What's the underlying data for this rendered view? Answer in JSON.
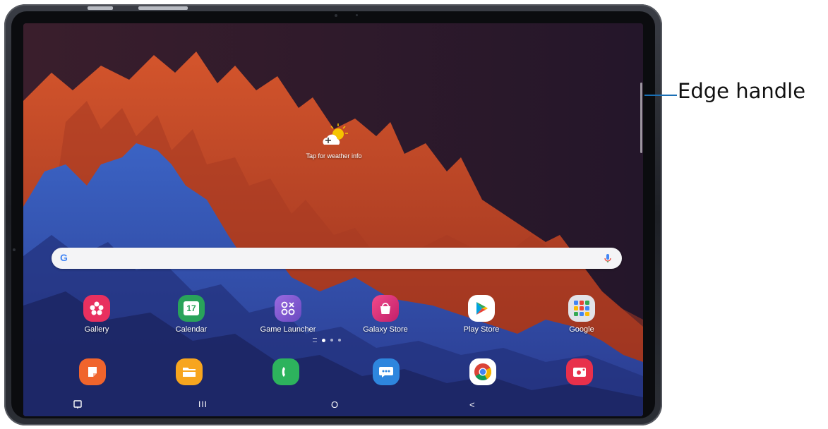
{
  "weather": {
    "label": "Tap for weather info"
  },
  "search": {
    "logo": "G",
    "placeholder": ""
  },
  "apps_row1": [
    {
      "label": "Gallery",
      "icon": "gallery-icon",
      "color": "#e8305f"
    },
    {
      "label": "Calendar",
      "icon": "calendar-icon",
      "color": "#29a35a",
      "badge": "17"
    },
    {
      "label": "Game Launcher",
      "icon": "game-launcher-icon",
      "color": "#7d5cc9",
      "glyph": "OX OO"
    },
    {
      "label": "Galaxy Store",
      "icon": "galaxy-store-icon",
      "color": "#e2347a"
    },
    {
      "label": "Play Store",
      "icon": "play-store-icon",
      "color": "#ffffff"
    },
    {
      "label": "Google",
      "icon": "google-folder-icon",
      "color": "#dcdde2"
    }
  ],
  "dock": [
    {
      "icon": "notes-icon",
      "color": "#f0642c"
    },
    {
      "icon": "my-files-icon",
      "color": "#f7a51e"
    },
    {
      "icon": "phone-icon",
      "color": "#2db35d"
    },
    {
      "icon": "messages-icon",
      "color": "#2e86de"
    },
    {
      "icon": "chrome-icon",
      "color": "#ffffff"
    },
    {
      "icon": "screen-recorder-icon",
      "color": "#e8304b"
    }
  ],
  "page_indicator": {
    "pages": 3,
    "active": 1
  },
  "navbar": {
    "recents": "III",
    "home": "O",
    "back": "<"
  },
  "callout": {
    "label": "Edge handle"
  }
}
